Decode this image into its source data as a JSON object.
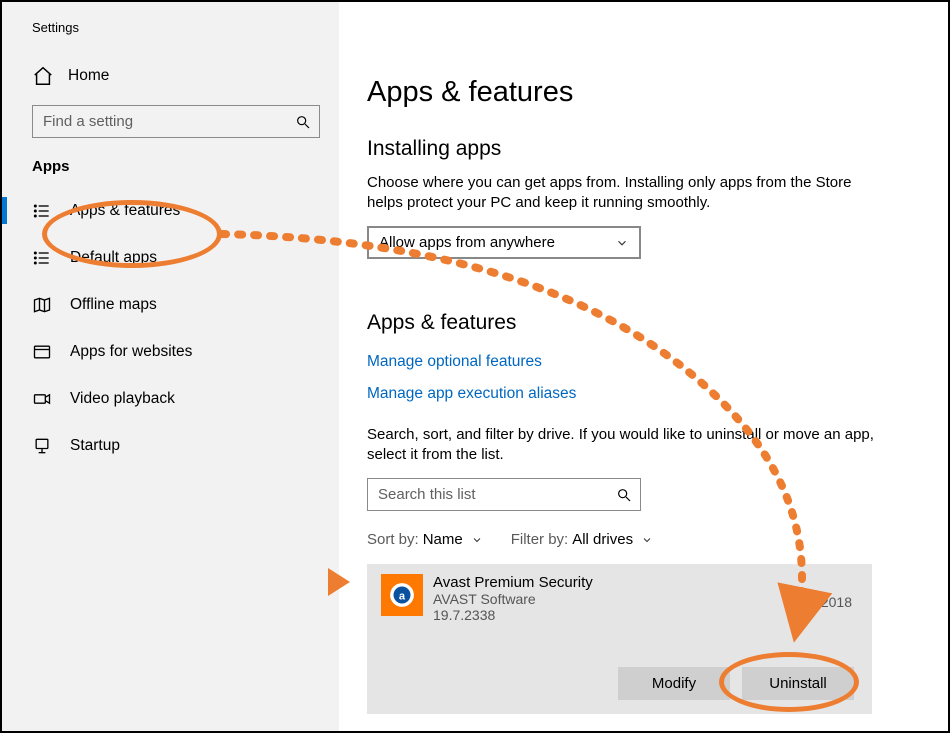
{
  "window": {
    "title": "Settings"
  },
  "sidebar": {
    "home": "Home",
    "search_placeholder": "Find a setting",
    "section": "Apps",
    "items": [
      {
        "label": "Apps & features"
      },
      {
        "label": "Default apps"
      },
      {
        "label": "Offline maps"
      },
      {
        "label": "Apps for websites"
      },
      {
        "label": "Video playback"
      },
      {
        "label": "Startup"
      }
    ]
  },
  "main": {
    "title": "Apps & features",
    "install_heading": "Installing apps",
    "install_desc": "Choose where you can get apps from. Installing only apps from the Store helps protect your PC and keep it running smoothly.",
    "install_select": "Allow apps from anywhere",
    "apps_heading": "Apps & features",
    "link_optional": "Manage optional features",
    "link_aliases": "Manage app execution aliases",
    "apps_desc": "Search, sort, and filter by drive. If you would like to uninstall or move an app, select it from the list.",
    "search_list_placeholder": "Search this list",
    "sort_label": "Sort by:",
    "sort_value": "Name",
    "filter_label": "Filter by:",
    "filter_value": "All drives"
  },
  "app": {
    "name": "Avast Premium Security",
    "vendor": "AVAST Software",
    "version": "19.7.2338",
    "date": "0/2018",
    "modify": "Modify",
    "uninstall": "Uninstall"
  }
}
